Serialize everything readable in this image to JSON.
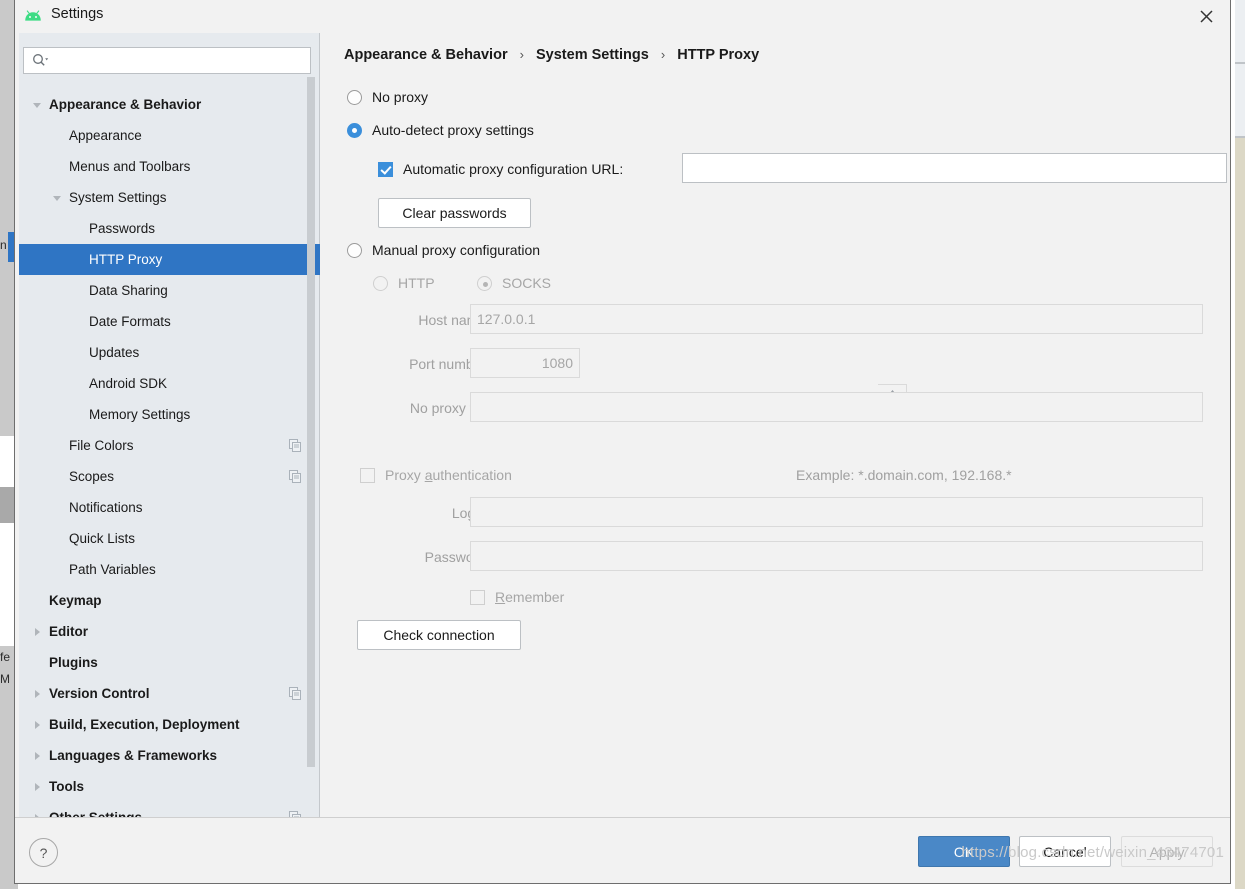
{
  "window": {
    "title": "Settings",
    "logo_icon": "android-logo-icon",
    "close_icon": "close-icon"
  },
  "search": {
    "placeholder": "",
    "value": "",
    "icon": "search-icon"
  },
  "sidebar": {
    "items": [
      {
        "label": "Appearance & Behavior",
        "indent": 30,
        "bold": true,
        "arrow": "down",
        "selected": false,
        "copy": false
      },
      {
        "label": "Appearance",
        "indent": 50,
        "bold": false,
        "arrow": "none",
        "selected": false,
        "copy": false
      },
      {
        "label": "Menus and Toolbars",
        "indent": 50,
        "bold": false,
        "arrow": "none",
        "selected": false,
        "copy": false
      },
      {
        "label": "System Settings",
        "indent": 50,
        "bold": false,
        "arrow": "down",
        "selected": false,
        "copy": false
      },
      {
        "label": "Passwords",
        "indent": 70,
        "bold": false,
        "arrow": "none",
        "selected": false,
        "copy": false
      },
      {
        "label": "HTTP Proxy",
        "indent": 70,
        "bold": false,
        "arrow": "none",
        "selected": true,
        "copy": false
      },
      {
        "label": "Data Sharing",
        "indent": 70,
        "bold": false,
        "arrow": "none",
        "selected": false,
        "copy": false
      },
      {
        "label": "Date Formats",
        "indent": 70,
        "bold": false,
        "arrow": "none",
        "selected": false,
        "copy": false
      },
      {
        "label": "Updates",
        "indent": 70,
        "bold": false,
        "arrow": "none",
        "selected": false,
        "copy": false
      },
      {
        "label": "Android SDK",
        "indent": 70,
        "bold": false,
        "arrow": "none",
        "selected": false,
        "copy": false
      },
      {
        "label": "Memory Settings",
        "indent": 70,
        "bold": false,
        "arrow": "none",
        "selected": false,
        "copy": false
      },
      {
        "label": "File Colors",
        "indent": 50,
        "bold": false,
        "arrow": "none",
        "selected": false,
        "copy": true
      },
      {
        "label": "Scopes",
        "indent": 50,
        "bold": false,
        "arrow": "none",
        "selected": false,
        "copy": true
      },
      {
        "label": "Notifications",
        "indent": 50,
        "bold": false,
        "arrow": "none",
        "selected": false,
        "copy": false
      },
      {
        "label": "Quick Lists",
        "indent": 50,
        "bold": false,
        "arrow": "none",
        "selected": false,
        "copy": false
      },
      {
        "label": "Path Variables",
        "indent": 50,
        "bold": false,
        "arrow": "none",
        "selected": false,
        "copy": false
      },
      {
        "label": "Keymap",
        "indent": 30,
        "bold": true,
        "arrow": "none",
        "selected": false,
        "copy": false
      },
      {
        "label": "Editor",
        "indent": 30,
        "bold": true,
        "arrow": "right",
        "selected": false,
        "copy": false
      },
      {
        "label": "Plugins",
        "indent": 30,
        "bold": true,
        "arrow": "none",
        "selected": false,
        "copy": false
      },
      {
        "label": "Version Control",
        "indent": 30,
        "bold": true,
        "arrow": "right",
        "selected": false,
        "copy": true
      },
      {
        "label": "Build, Execution, Deployment",
        "indent": 30,
        "bold": true,
        "arrow": "right",
        "selected": false,
        "copy": false
      },
      {
        "label": "Languages & Frameworks",
        "indent": 30,
        "bold": true,
        "arrow": "right",
        "selected": false,
        "copy": false
      },
      {
        "label": "Tools",
        "indent": 30,
        "bold": true,
        "arrow": "right",
        "selected": false,
        "copy": false
      },
      {
        "label": "Other Settings",
        "indent": 30,
        "bold": true,
        "arrow": "right",
        "selected": false,
        "copy": true
      }
    ]
  },
  "breadcrumb": {
    "part1": "Appearance & Behavior",
    "part2": "System Settings",
    "part3": "HTTP Proxy",
    "separator": "›"
  },
  "proxy": {
    "no_proxy_label": "No proxy",
    "auto_detect_label": "Auto-detect proxy settings",
    "auto_config_url_label": "Automatic proxy configuration URL:",
    "auto_config_url_value": "",
    "clear_passwords_label": "Clear passwords",
    "manual_label": "Manual proxy configuration",
    "http_label": "HTTP",
    "socks_label": "SOCKS",
    "host_name_label": "Host name:",
    "host_name_value": "127.0.0.1",
    "port_number_label": "Port number:",
    "port_number_value": "1080",
    "no_proxy_for_label": "No proxy for:",
    "no_proxy_for_value": "",
    "example_text": "Example: *.domain.com, 192.168.*",
    "proxy_auth_label_pre": "Proxy ",
    "proxy_auth_label_mnemonic": "a",
    "proxy_auth_label_post": "uthentication",
    "login_label": "Login:",
    "login_value": "",
    "password_label": "Password:",
    "password_value": "",
    "remember_label_mnemonic": "R",
    "remember_label_post": "emember",
    "check_connection_label": "Check connection",
    "expand_icon": "expand-icon",
    "spinner_icon": "spinner-arrows-icon",
    "selected_mode": "auto-detect",
    "selected_manual_protocol": "SOCKS"
  },
  "footer": {
    "help_label": "?",
    "ok_label": "OK",
    "cancel_label": "Cancel",
    "apply_label": "Apply",
    "watermark": "https://blog.csdn.net/weixin_43474701"
  },
  "colors": {
    "accent": "#2f75c4",
    "ok_button": "#4a88c7",
    "checkbox_checked": "#3b8fdb",
    "panel_bg": "#f2f2f2",
    "tree_bg": "#e6eaee",
    "disabled_text": "#a6a6a6"
  },
  "background_app": {
    "left_fragments": [
      "n",
      "fe",
      "M"
    ],
    "right_visible": true
  }
}
